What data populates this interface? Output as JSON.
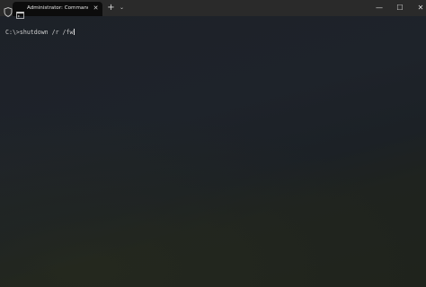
{
  "window": {
    "tab_title": "Administrator: Command Prom",
    "tab_close_glyph": "✕",
    "new_tab_glyph": "+",
    "dropdown_glyph": "⌄",
    "minimize_glyph": "—",
    "maximize_glyph": "☐",
    "close_glyph": "✕"
  },
  "terminal": {
    "prompt": "C:\\>",
    "command": "shutdown /r /fw"
  },
  "icons": {
    "shield": "shield-icon",
    "tab": "terminal-icon"
  },
  "colors": {
    "titlebar": "#2a2a2a",
    "tab_active": "#0c0c0c",
    "text": "#cccccc"
  }
}
